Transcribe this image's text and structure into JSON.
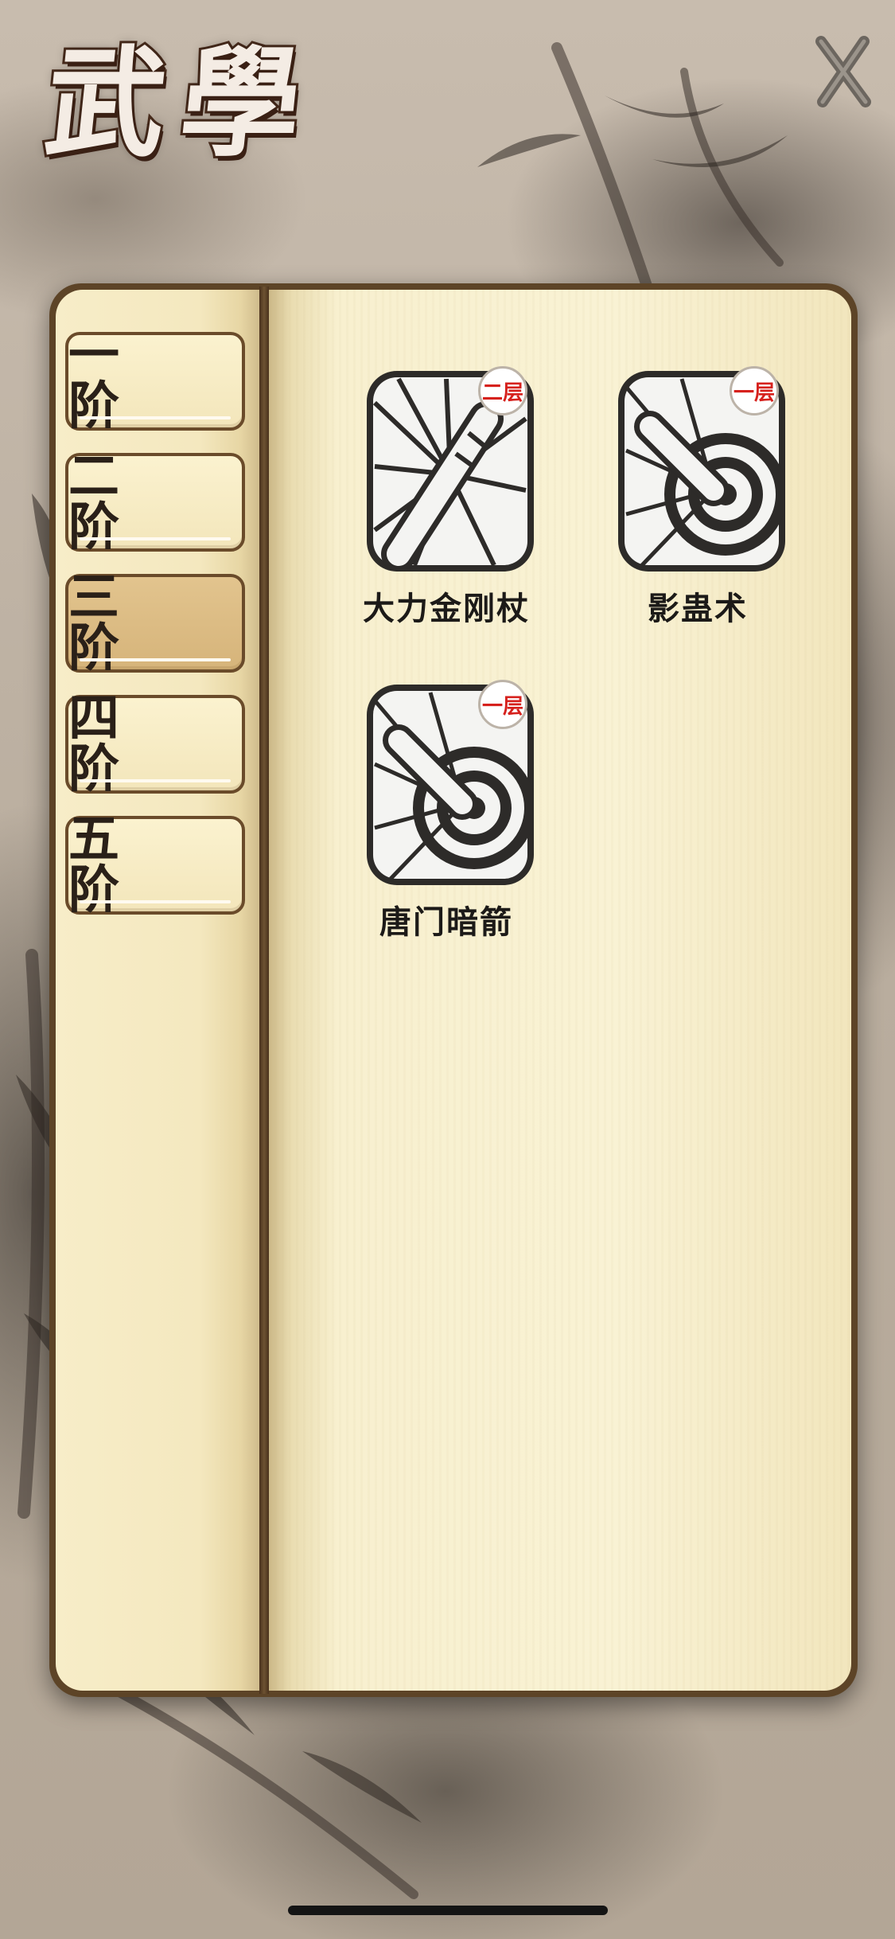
{
  "header": {
    "title": "武學",
    "close_icon": "close-x-icon"
  },
  "tiers": [
    {
      "label": "一 阶",
      "active": false
    },
    {
      "label": "二 阶",
      "active": false
    },
    {
      "label": "三 阶",
      "active": true
    },
    {
      "label": "四 阶",
      "active": false
    },
    {
      "label": "五 阶",
      "active": false
    }
  ],
  "skills": [
    {
      "name": "大力金刚杖",
      "level": "二层",
      "icon": "staff-strike-icon"
    },
    {
      "name": "影蛊术",
      "level": "一层",
      "icon": "target-thrust-icon"
    },
    {
      "name": "唐门暗箭",
      "level": "一层",
      "icon": "target-thrust-icon"
    }
  ],
  "colors": {
    "book_frame": "#5d4427",
    "active_tab": "#d6b47a",
    "badge_text": "#d6211d"
  }
}
